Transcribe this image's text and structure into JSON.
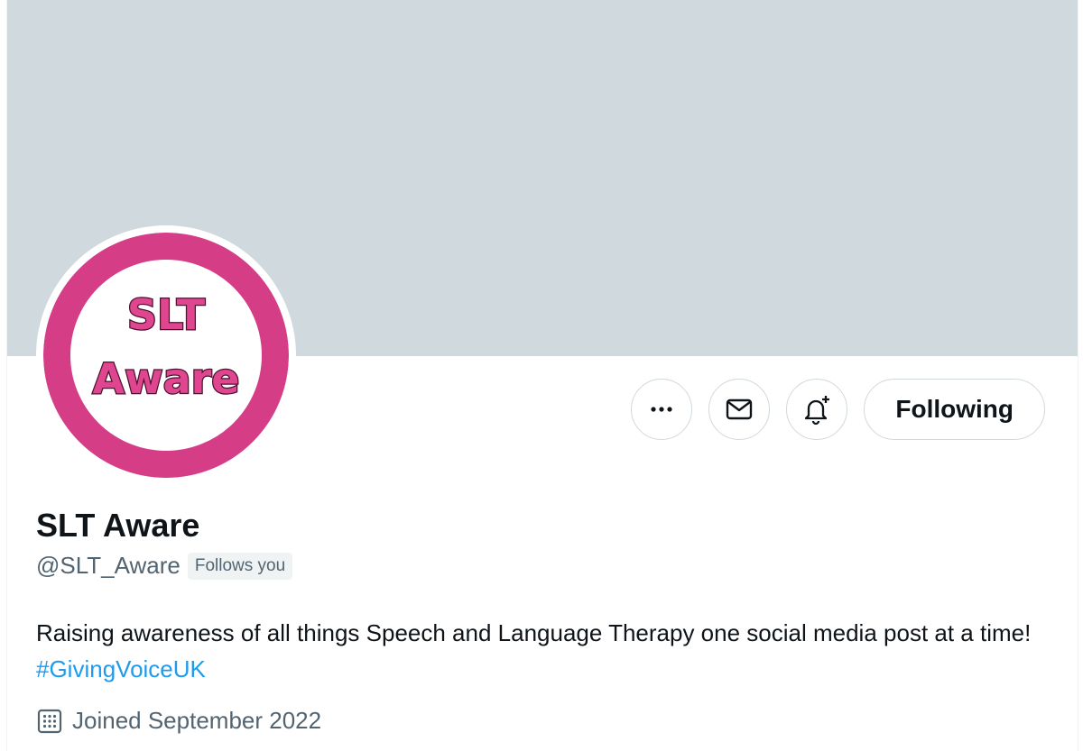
{
  "profile": {
    "avatar_text_line1": "SLT",
    "avatar_text_line2": "Aware",
    "name": "SLT Aware",
    "handle": "@SLT_Aware",
    "follows_you_badge": "Follows you",
    "bio_text": "Raising awareness of all things Speech and Language Therapy one social media post at a time! ",
    "bio_hashtag": "#GivingVoiceUK",
    "joined": "Joined September 2022"
  },
  "actions": {
    "more_icon": "more-icon",
    "message_icon": "envelope-icon",
    "notify_icon": "bell-plus-icon",
    "following_label": "Following"
  },
  "colors": {
    "banner": "#cfd9de",
    "avatar_ring": "#d63d87",
    "link": "#1d9bf0",
    "text_primary": "#0f1419",
    "text_secondary": "#536471"
  }
}
